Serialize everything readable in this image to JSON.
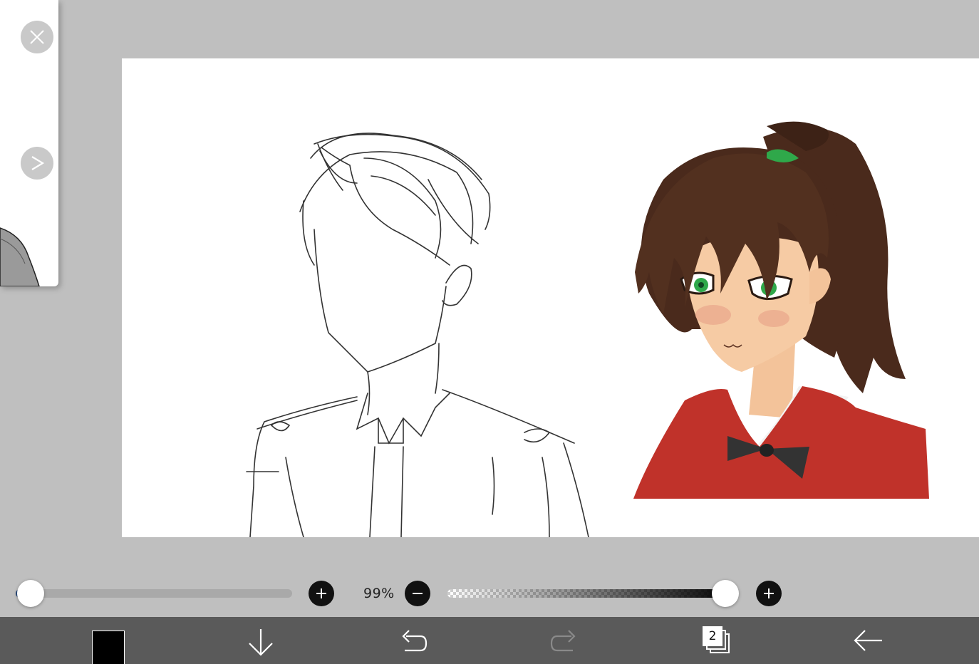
{
  "reference_panel": {
    "close_icon": "close-icon",
    "next_icon": "chevron-right-icon"
  },
  "brush": {
    "size_fraction": 0.0,
    "size_color": "#2a4d80"
  },
  "opacity": {
    "label": "99%",
    "value_percent": 99
  },
  "toolbar": {
    "color": "#000000",
    "layer_count": "2",
    "icons": [
      "color-swatch",
      "download-icon",
      "undo-icon",
      "redo-icon",
      "layers-icon",
      "back-icon"
    ]
  },
  "colors": {
    "background": "#bfbfbf",
    "toolbar": "#5a5a5a",
    "hair": "#4a2a1c",
    "dress": "#c0322a",
    "eyes": "#2fa84a",
    "skin": "#f3c39a"
  }
}
